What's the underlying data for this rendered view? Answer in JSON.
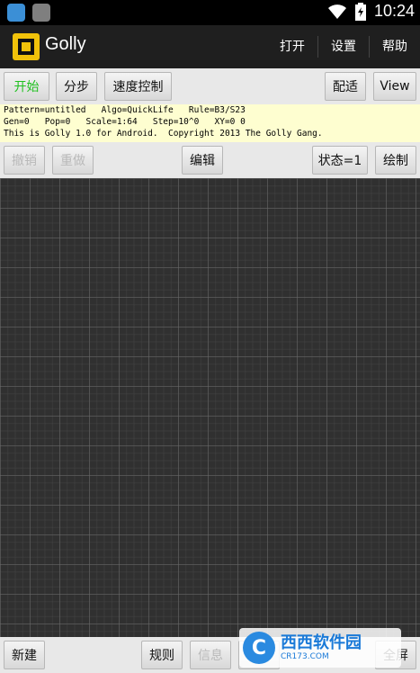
{
  "status_bar": {
    "time": "10:24"
  },
  "action_bar": {
    "title": "Golly",
    "menu": {
      "open": "打开",
      "settings": "设置",
      "help": "帮助"
    }
  },
  "toolbar_top": {
    "start": "开始",
    "step": "分步",
    "speed": "速度控制",
    "fit": "配适",
    "view": "View"
  },
  "info": {
    "line1": "Pattern=untitled   Algo=QuickLife   Rule=B3/S23",
    "line2": "Gen=0   Pop=0   Scale=1:64   Step=10^0   XY=0 0",
    "line3": "This is Golly 1.0 for Android.  Copyright 2013 The Golly Gang."
  },
  "toolbar_edit": {
    "undo": "撤销",
    "redo": "重做",
    "edit": "编辑",
    "state": "状态=1",
    "draw": "绘制"
  },
  "toolbar_bottom": {
    "new": "新建",
    "rule": "规则",
    "info": "信息",
    "save": "保存",
    "fullscreen": "全屏"
  },
  "watermark": {
    "brand": "西西软件园",
    "url": "CR173.COM"
  },
  "colors": {
    "start_text": "#20c020",
    "info_bg": "#fefed0",
    "canvas_bg": "#303030",
    "app_icon": "#f1c20a"
  }
}
